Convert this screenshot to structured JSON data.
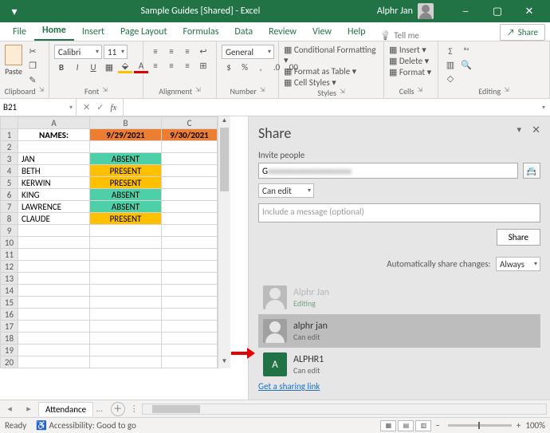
{
  "titlebar": {
    "title": "Sample Guides  [Shared]  -  Excel",
    "user": "Alphr Jan"
  },
  "menu": {
    "tabs": [
      "File",
      "Home",
      "Insert",
      "Page Layout",
      "Formulas",
      "Data",
      "Review",
      "View",
      "Help"
    ],
    "tell": "Tell me",
    "share": "Share"
  },
  "ribbon": {
    "clipboard": {
      "paste": "Paste",
      "label": "Clipboard"
    },
    "font": {
      "name": "Calibri",
      "size": "11",
      "label": "Font"
    },
    "alignment": {
      "label": "Alignment"
    },
    "number": {
      "format": "General",
      "label": "Number"
    },
    "styles": {
      "cond": "Conditional Formatting",
      "table": "Format as Table",
      "cell": "Cell Styles",
      "label": "Styles"
    },
    "cells": {
      "insert": "Insert",
      "delete": "Delete",
      "format": "Format",
      "label": "Cells"
    },
    "editing": {
      "label": "Editing"
    }
  },
  "namebox": "B21",
  "sheet": {
    "columns": [
      "A",
      "B",
      "C"
    ],
    "header_row": {
      "a": "NAMES:",
      "b": "9/29/2021",
      "c": "9/30/2021"
    },
    "rows": [
      {
        "n": "2",
        "a": "",
        "b": "",
        "c": ""
      },
      {
        "n": "3",
        "a": "JAN",
        "b": "ABSENT",
        "c": ""
      },
      {
        "n": "4",
        "a": "BETH",
        "b": "PRESENT",
        "c": ""
      },
      {
        "n": "5",
        "a": "KERWIN",
        "b": "PRESENT",
        "c": ""
      },
      {
        "n": "6",
        "a": "KING",
        "b": "ABSENT",
        "c": ""
      },
      {
        "n": "7",
        "a": "LAWRENCE",
        "b": "ABSENT",
        "c": ""
      },
      {
        "n": "8",
        "a": "CLAUDE",
        "b": "PRESENT",
        "c": ""
      }
    ],
    "tab": "Attendance"
  },
  "share": {
    "title": "Share",
    "invite_label": "Invite people",
    "email_value": "G",
    "perm": "Can edit",
    "msg_placeholder": "Include a message (optional)",
    "btn": "Share",
    "auto_label": "Automatically share changes:",
    "auto_value": "Always",
    "people": [
      {
        "name": "Alphr Jan",
        "status": "Editing",
        "avatar": "gray",
        "statusClass": "ed",
        "faded": true
      },
      {
        "name": "alphr jan",
        "status": "Can edit",
        "avatar": "gray",
        "hl": true
      },
      {
        "name": "ALPHR1",
        "status": "Can edit",
        "avatar": "green",
        "initial": "A"
      }
    ],
    "link": "Get a sharing link"
  },
  "status": {
    "ready": "Ready",
    "acc": "Accessibility: Good to go",
    "zoom": "100%"
  }
}
